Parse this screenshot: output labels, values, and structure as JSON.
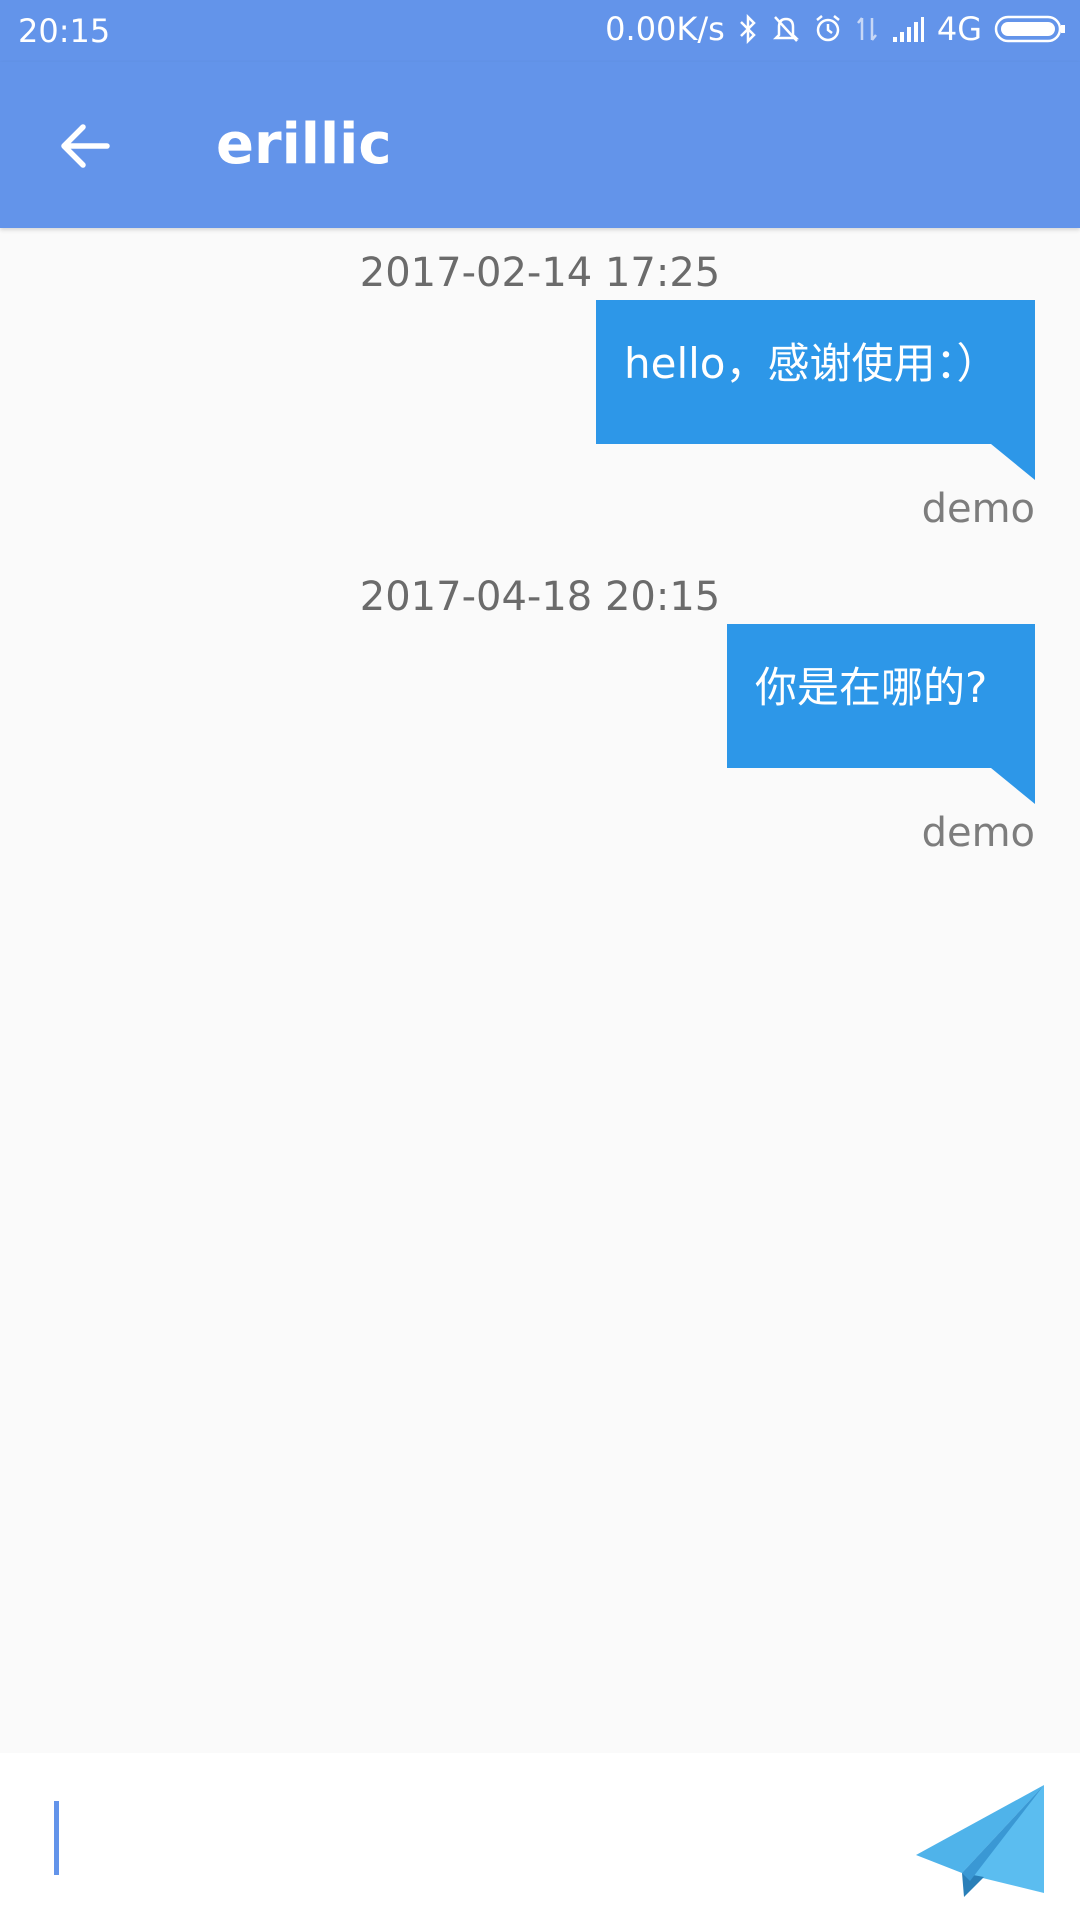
{
  "status_bar": {
    "time": "20:15",
    "speed": "0.00K/s",
    "network": "4G"
  },
  "header": {
    "title": "erillic"
  },
  "messages": [
    {
      "timestamp": "2017-02-14 17:25",
      "text": "hello，感谢使用：）",
      "sender": "demo"
    },
    {
      "timestamp": "2017-04-18 20:15",
      "text": "你是在哪的?",
      "sender": "demo"
    }
  ],
  "composer": {
    "value": "",
    "placeholder": ""
  },
  "colors": {
    "primary": "#6394ea",
    "bubble": "#2d97e8",
    "send_icon": "#4fb3ea"
  }
}
